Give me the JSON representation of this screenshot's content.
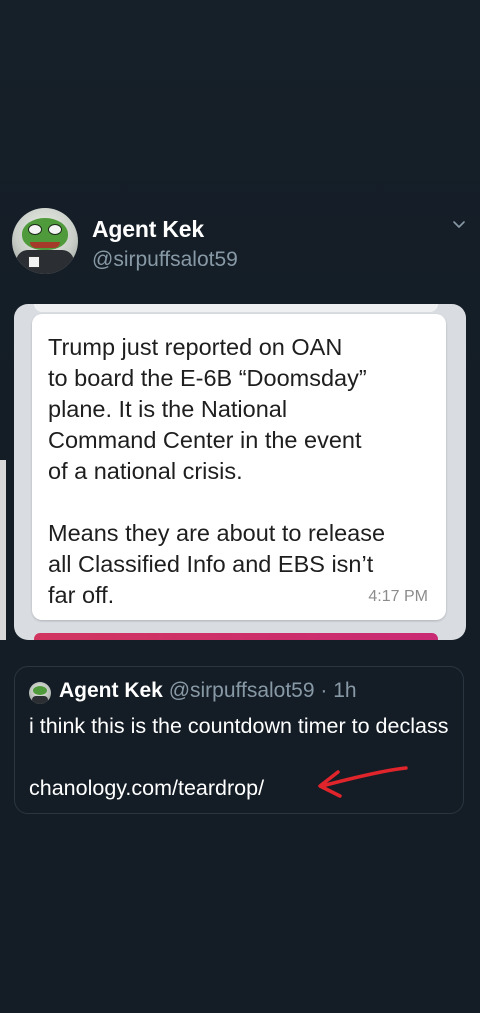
{
  "tweet": {
    "display_name": "Agent Kek",
    "handle": "@sirpuffsalot59",
    "menu_icon": "chevron-down-icon"
  },
  "media": {
    "message_text": "Trump just reported on OAN\nto board the E-6B “Doomsday”\nplane.  It is the National\nCommand Center in the event\nof a national crisis.\n\nMeans they are about to release\nall Classified Info and EBS isn’t\nfar off.",
    "time": "4:17 PM"
  },
  "quote": {
    "display_name": "Agent Kek",
    "handle": "@sirpuffsalot59",
    "separator": "·",
    "time": "1h",
    "text": "i think this is the countdown timer to declass",
    "link": "chanology.com/teardrop/"
  },
  "colors": {
    "background": "#141d26",
    "secondary_text": "#8899a6",
    "arrow": "#e0242b"
  }
}
